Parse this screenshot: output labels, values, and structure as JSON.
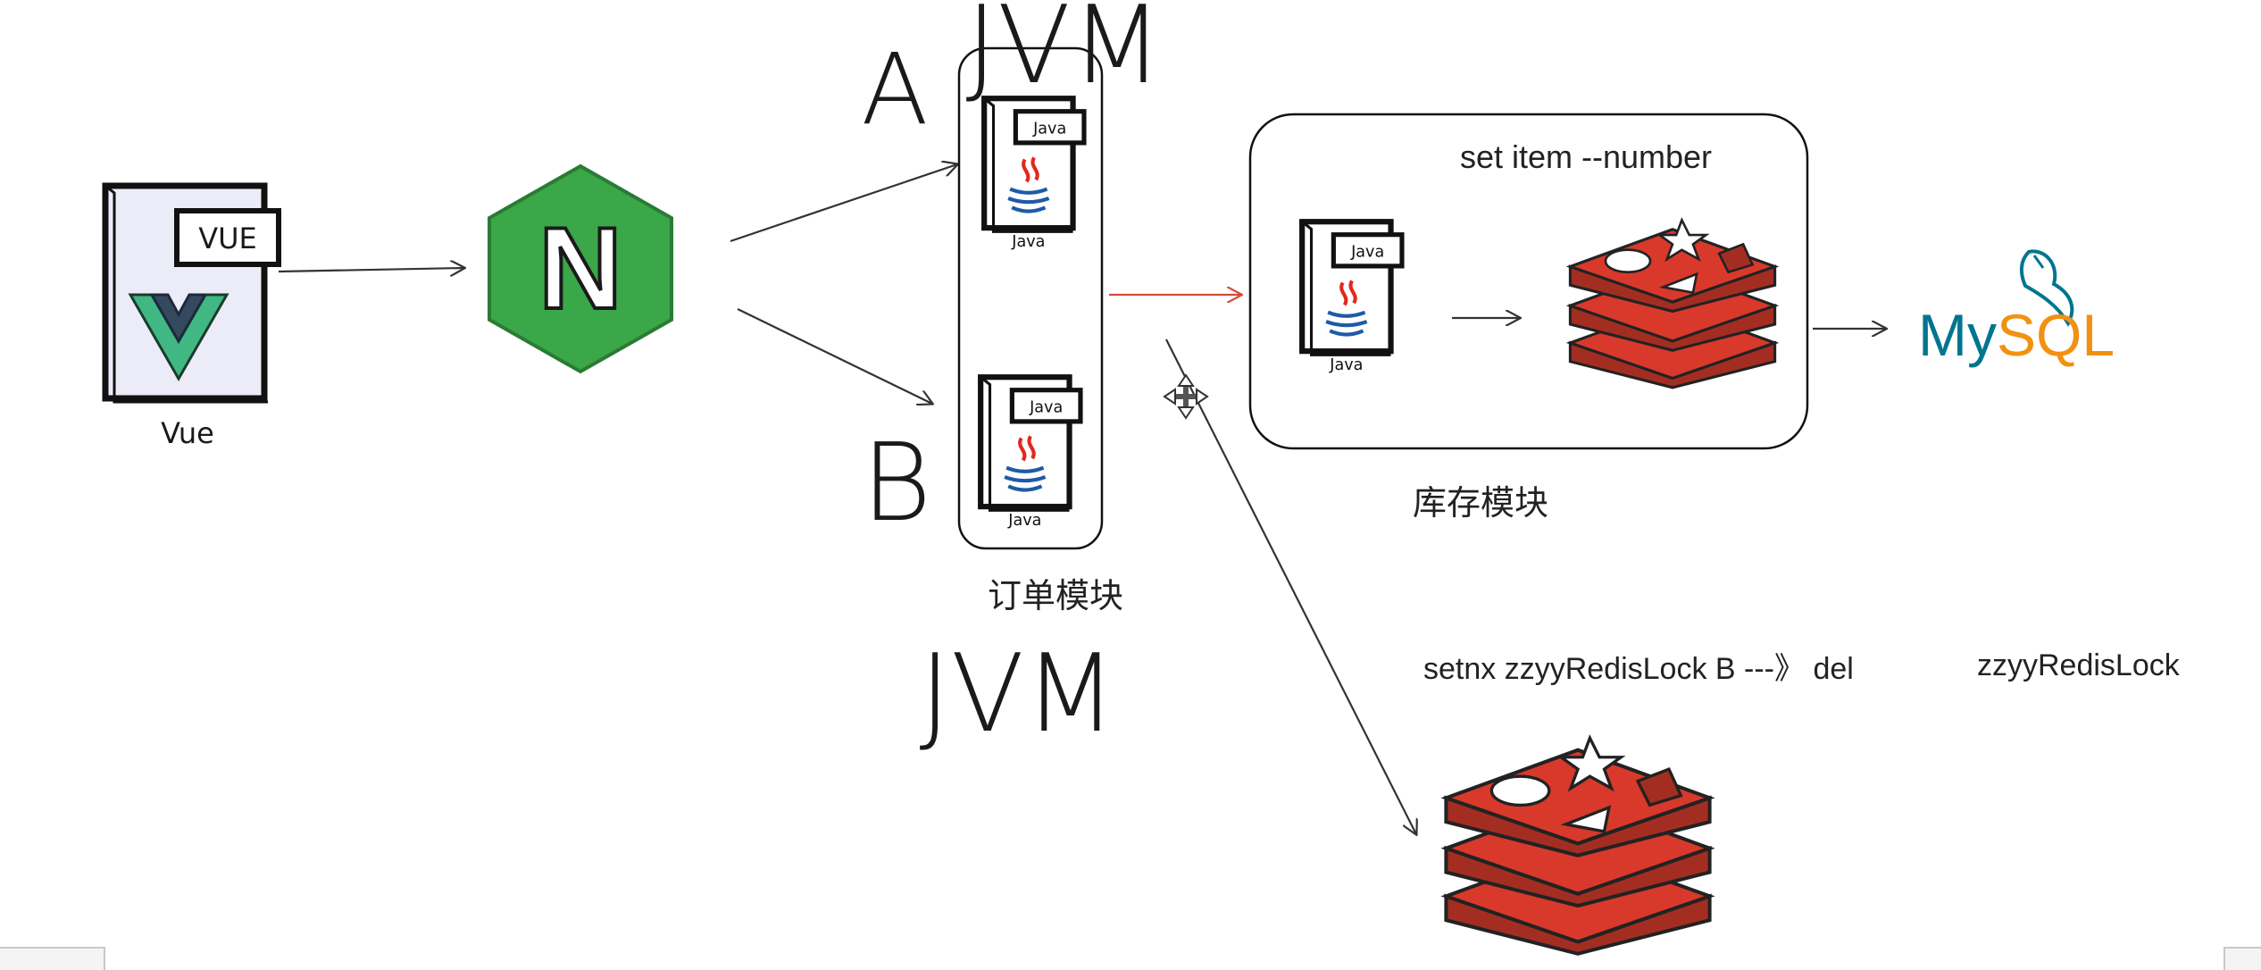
{
  "vue": {
    "badge": "VUE",
    "caption": "Vue"
  },
  "nginx": {
    "letter": "N"
  },
  "jvm_top": {
    "letter_a": "A",
    "title": "JVM"
  },
  "jvm_bottom": {
    "title": "JVM",
    "letter_b": "B"
  },
  "java_label": "Java",
  "order_module": {
    "caption": "订单模块"
  },
  "stock_module": {
    "caption": "库存模块",
    "command": "set item --number"
  },
  "mysql": {
    "part1": "My",
    "part2": "SQL"
  },
  "lock_command": {
    "text": "setnx zzyyRedisLock B ---》  del",
    "key": "zzyyRedisLock"
  },
  "colors": {
    "nginx_green": "#3aa748",
    "redis_red": "#d8392b",
    "mysql_blue": "#00758f",
    "mysql_orange": "#f29111",
    "arrow_red": "#d9493a",
    "vue_green": "#41b883",
    "vue_dark": "#35495e"
  }
}
